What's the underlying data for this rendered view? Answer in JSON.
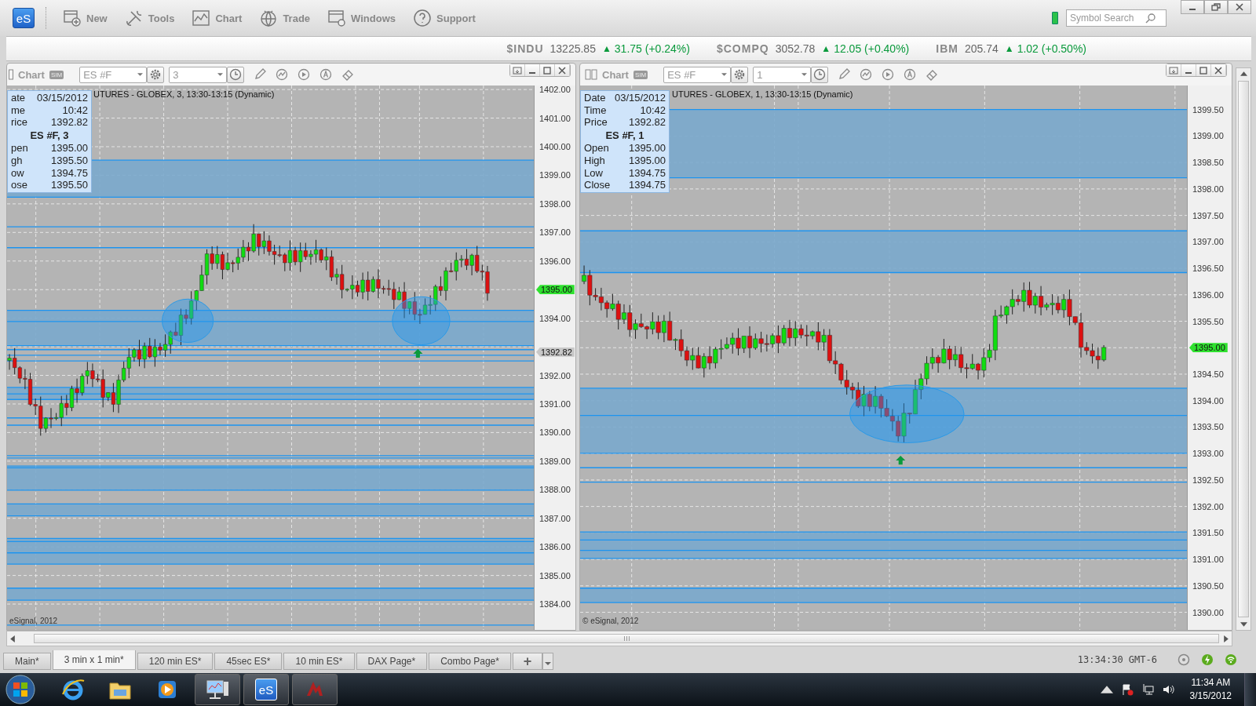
{
  "app_toolbar": {
    "logo": "eS",
    "buttons": [
      {
        "label": "New"
      },
      {
        "label": "Tools"
      },
      {
        "label": "Chart"
      },
      {
        "label": "Trade"
      },
      {
        "label": "Windows"
      },
      {
        "label": "Support"
      }
    ],
    "symbol_search": {
      "placeholder": "Symbol Search"
    }
  },
  "ticker": [
    {
      "symbol": "$INDU",
      "last": "13225.85",
      "arrow": "▲",
      "change": "31.75 (+0.24%)"
    },
    {
      "symbol": "$COMPQ",
      "last": "3052.78",
      "arrow": "▲",
      "change": "12.05 (+0.40%)"
    },
    {
      "symbol": "IBM",
      "last": "205.74",
      "arrow": "▲",
      "change": "1.02 (+0.50%)"
    }
  ],
  "charts": [
    {
      "title": "Chart",
      "badge": "SIM",
      "symbol": "ES #F",
      "interval": "3",
      "caption": "UTURES - GLOBEX, 3, 13:30-13:15 (Dynamic)",
      "info_top": [
        {
          "label": "ate",
          "value": "03/15/2012"
        },
        {
          "label": "me",
          "value": "10:42"
        },
        {
          "label": "rice",
          "value": "1392.82"
        }
      ],
      "info_heading": "ES #F, 3",
      "info_bottom": [
        {
          "label": "pen",
          "value": "1395.00"
        },
        {
          "label": "gh",
          "value": "1395.50"
        },
        {
          "label": "ow",
          "value": "1394.75"
        },
        {
          "label": "ose",
          "value": "1395.50"
        }
      ],
      "copyright": "eSignal, 2012",
      "y_ticks": [
        "1402.00",
        "1401.00",
        "1400.00",
        "1399.00",
        "1398.00",
        "1397.00",
        "1396.00",
        "1394.00",
        "1392.00",
        "1391.00",
        "1390.00",
        "1389.00",
        "1388.00",
        "1387.00",
        "1386.00",
        "1385.00",
        "1384.00"
      ],
      "price_markers": [
        {
          "kind": "last",
          "value": "1395.00"
        },
        {
          "kind": "cursor",
          "value": "1392.82"
        }
      ]
    },
    {
      "title": "Chart",
      "badge": "SIM",
      "symbol": "ES #F",
      "interval": "1",
      "caption": "UTURES - GLOBEX, 1, 13:30-13:15 (Dynamic)",
      "info_top": [
        {
          "label": "Date",
          "value": "03/15/2012"
        },
        {
          "label": "Time",
          "value": "10:42"
        },
        {
          "label": "Price",
          "value": "1392.82"
        }
      ],
      "info_heading": "ES #F, 1",
      "info_bottom": [
        {
          "label": "Open",
          "value": "1395.00"
        },
        {
          "label": "High",
          "value": "1395.00"
        },
        {
          "label": "Low",
          "value": "1394.75"
        },
        {
          "label": "Close",
          "value": "1394.75"
        }
      ],
      "copyright": "© eSignal, 2012",
      "y_ticks": [
        "1399.50",
        "1399.00",
        "1398.50",
        "1398.00",
        "1397.50",
        "1397.00",
        "1396.50",
        "1396.00",
        "1395.50",
        "1394.50",
        "1394.00",
        "1393.50",
        "1393.00",
        "1392.50",
        "1392.00",
        "1391.50",
        "1391.00",
        "1390.50",
        "1390.00"
      ],
      "price_markers": [
        {
          "kind": "last",
          "value": "1395.00"
        }
      ]
    }
  ],
  "page_tabs": [
    {
      "label": "Main*",
      "selected": false
    },
    {
      "label": "3 min x 1 min*",
      "selected": true
    },
    {
      "label": "120 min ES*",
      "selected": false
    },
    {
      "label": "45sec ES*",
      "selected": false
    },
    {
      "label": "10 min ES*",
      "selected": false
    },
    {
      "label": "DAX Page*",
      "selected": false
    },
    {
      "label": "Combo Page*",
      "selected": false
    }
  ],
  "add_tab": "+",
  "status": {
    "time": "13:34:30 GMT-6"
  },
  "taskbar": {
    "esignal_label": "eS",
    "clock_time": "11:34 AM",
    "clock_date": "3/15/2012"
  }
}
